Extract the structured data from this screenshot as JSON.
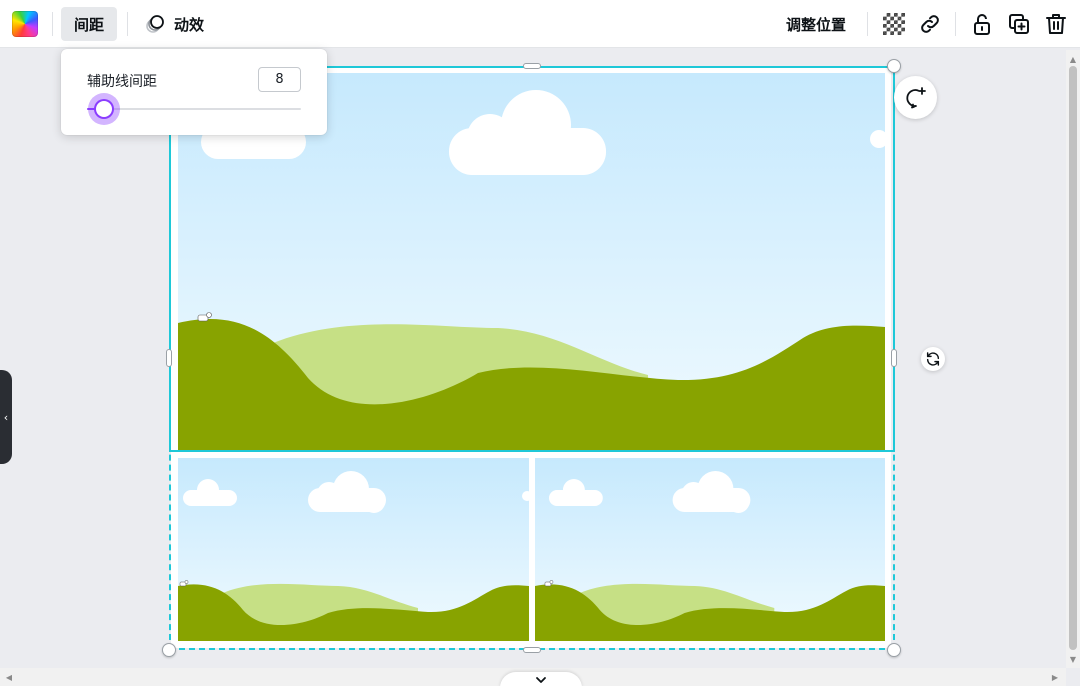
{
  "toolbar": {
    "color_icon": "rainbow-color-icon",
    "spacing_label": "间距",
    "animate_label": "动效",
    "adjust_position_label": "调整位置",
    "icons": [
      "transparency-icon",
      "link-icon",
      "unlock-icon",
      "duplicate-icon",
      "trash-icon"
    ]
  },
  "spacing_popup": {
    "label": "辅助线间距",
    "value": "8",
    "slider_level": 0.08,
    "accent": "#8b3dff"
  },
  "canvas": {
    "selection_color": "#1ec8d8",
    "sky_top": "#c6e9fd",
    "sky_bottom": "#eef9fe",
    "hill_dark": "#88a300",
    "hill_light": "#c6e085"
  },
  "floating": {
    "comment_icon": "add-comment-icon",
    "rotate_icon": "rotate-icon"
  }
}
